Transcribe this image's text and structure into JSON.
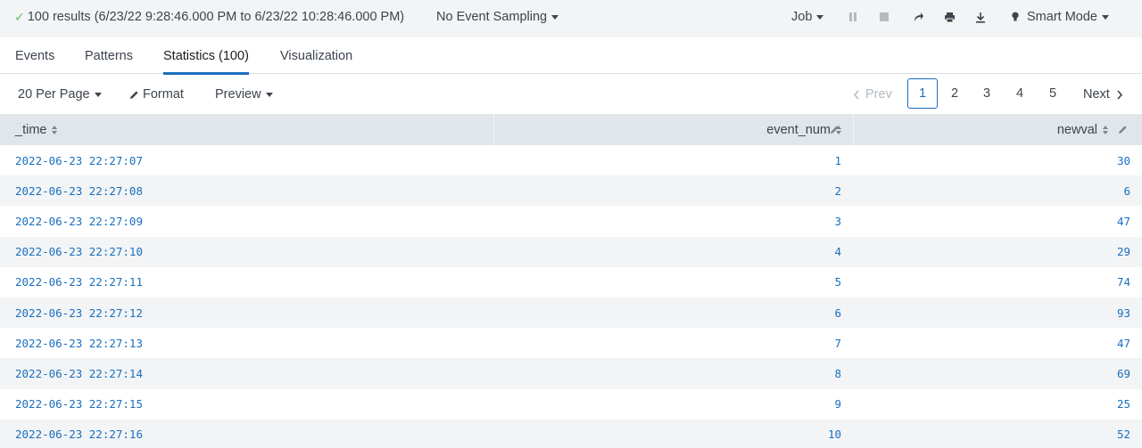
{
  "status": {
    "check_icon": "checkmark-icon",
    "results_text": "100 results (6/23/22 9:28:46.000 PM to 6/23/22 10:28:46.000 PM)",
    "sampling_label": "No Event Sampling",
    "job_label": "Job",
    "mode_label": "Smart Mode"
  },
  "tabs": [
    {
      "label": "Events"
    },
    {
      "label": "Patterns"
    },
    {
      "label": "Statistics (100)",
      "active": true
    },
    {
      "label": "Visualization"
    }
  ],
  "toolbar": {
    "per_page_label": "20 Per Page",
    "format_label": "Format",
    "preview_label": "Preview",
    "prev_label": "Prev",
    "next_label": "Next",
    "pages": [
      "1",
      "2",
      "3",
      "4",
      "5"
    ],
    "current_page": "1"
  },
  "table": {
    "columns": [
      "_time",
      "event_num",
      "newval"
    ],
    "rows": [
      [
        "2022-06-23 22:27:07",
        "1",
        "30"
      ],
      [
        "2022-06-23 22:27:08",
        "2",
        "6"
      ],
      [
        "2022-06-23 22:27:09",
        "3",
        "47"
      ],
      [
        "2022-06-23 22:27:10",
        "4",
        "29"
      ],
      [
        "2022-06-23 22:27:11",
        "5",
        "74"
      ],
      [
        "2022-06-23 22:27:12",
        "6",
        "93"
      ],
      [
        "2022-06-23 22:27:13",
        "7",
        "47"
      ],
      [
        "2022-06-23 22:27:14",
        "8",
        "69"
      ],
      [
        "2022-06-23 22:27:15",
        "9",
        "25"
      ],
      [
        "2022-06-23 22:27:16",
        "10",
        "52"
      ]
    ]
  },
  "colors": {
    "accent": "#1a6fbf",
    "success": "#5cc05c",
    "header_bg": "#e1e6ea",
    "stripe_bg": "#f2f4f5"
  }
}
